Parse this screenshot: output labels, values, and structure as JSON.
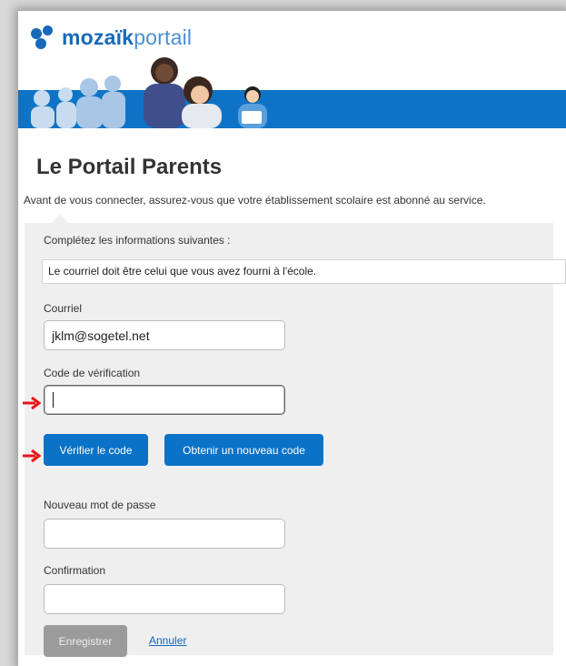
{
  "brand": {
    "name_bold": "mozaïk",
    "name_light": "portail",
    "color": "#1769b8",
    "banner_color": "#0e73c6"
  },
  "page": {
    "title": "Le Portail Parents",
    "intro": "Avant de vous connecter, assurez-vous que votre établissement scolaire est abonné au service."
  },
  "form": {
    "instructions": "Complétez les informations suivantes :",
    "notice": "Le courriel doit être celui que vous avez fourni à l'école.",
    "email_label": "Courriel",
    "email_value": "jklm@sogetel.net",
    "code_label": "Code de vérification",
    "code_value": "",
    "verify_button": "Vérifier le code",
    "new_code_button": "Obtenir un nouveau code",
    "new_password_label": "Nouveau mot de passe",
    "new_password_value": "",
    "confirmation_label": "Confirmation",
    "confirmation_value": "",
    "save_button": "Enregistrer",
    "cancel_link": "Annuler"
  },
  "colors": {
    "primary_button": "#0a72c7",
    "disabled_button": "#9b9b9b",
    "panel_bg": "#efefef",
    "annotation_arrow": "#e8131a"
  },
  "icons": {
    "annotation": "red-arrow-icon"
  }
}
